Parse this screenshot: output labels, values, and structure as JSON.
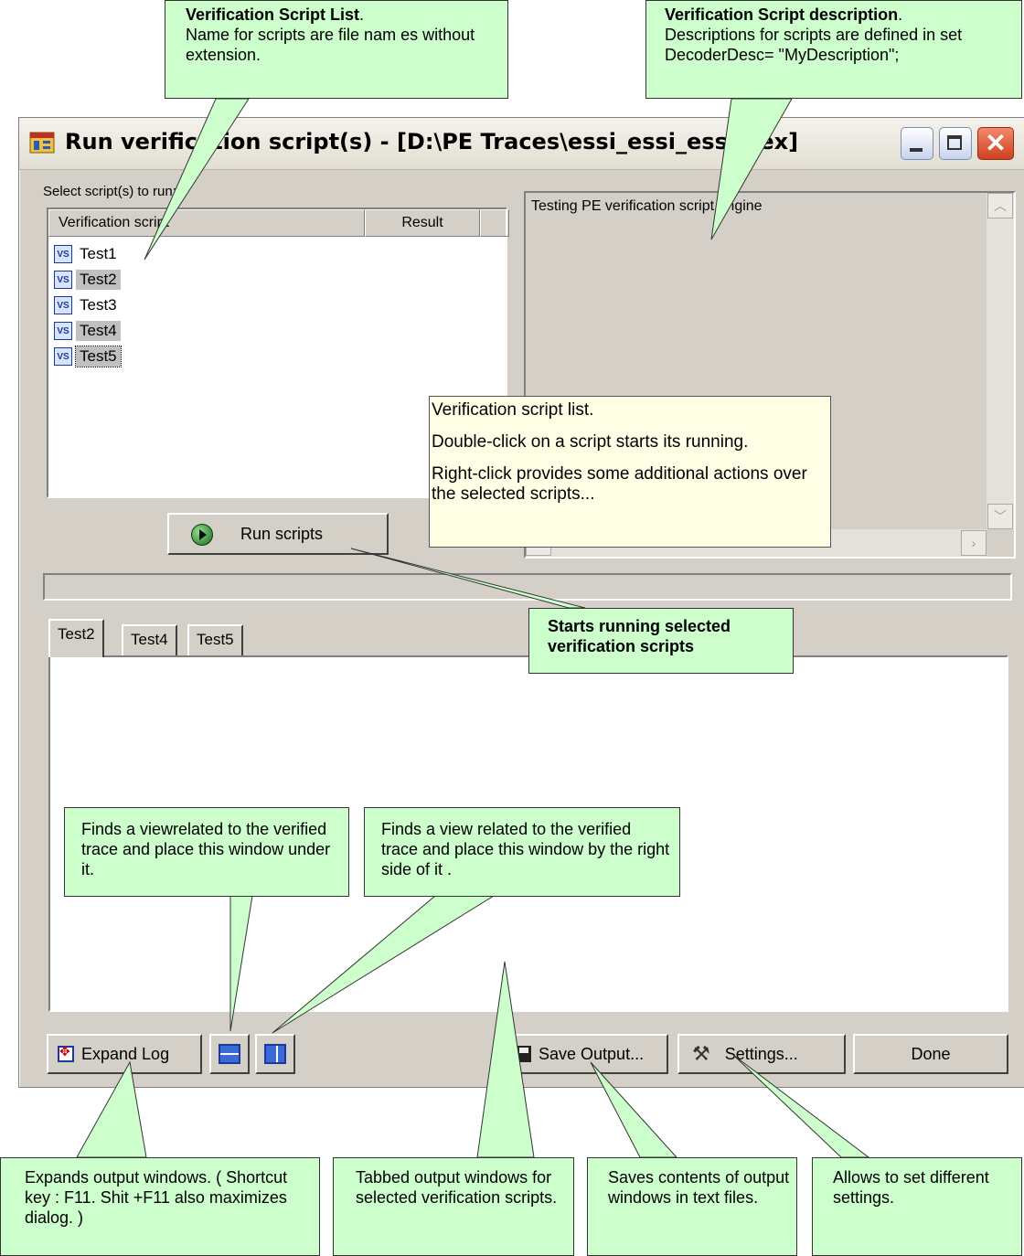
{
  "window": {
    "title": "Run verification script(s) - [D:\\PE Traces\\essi_essi_essi.pex]"
  },
  "script_panel": {
    "select_label": "Select script(s) to run:",
    "columns": [
      "Verification script",
      "Result",
      ""
    ],
    "scripts": [
      {
        "name": "Test1",
        "selected": false
      },
      {
        "name": "Test2",
        "selected": true
      },
      {
        "name": "Test3",
        "selected": false
      },
      {
        "name": "Test4",
        "selected": true
      },
      {
        "name": "Test5",
        "selected": true
      }
    ],
    "run_button": "Run scripts"
  },
  "description": {
    "text": "Testing PE verification script engine"
  },
  "tooltip": {
    "lines": [
      "Verification script list.",
      "Double-click on a script starts its running.",
      "Right-click provides some additional actions over the selected scripts..."
    ]
  },
  "tabs": [
    "Test2",
    "Test4",
    "Test5"
  ],
  "bottom_bar": {
    "expand_log": "Expand Log",
    "save_output": "Save Output...",
    "settings": "Settings...",
    "done": "Done"
  },
  "callouts": {
    "script_list": {
      "title": "Verification Script List",
      "body": "Name for scripts are file nam es without extension."
    },
    "script_desc": {
      "title": "Verification Script description",
      "body": "Descriptions for scripts are defined in set DecoderDesc=  \"MyDescription\";"
    },
    "run_selected": {
      "body": "Starts running selected verification scripts"
    },
    "view_under": {
      "body": "Finds a viewrelated to the verified trace and place this window under it."
    },
    "view_right": {
      "body": "Finds a view related to the verified trace and place this window  by the right side of it ."
    },
    "expand": {
      "body": "Expands output windows. ( Shortcut key : F11. Shit +F11 also maximizes dialog. )"
    },
    "tabbed": {
      "body": "Tabbed output windows for selected verification scripts."
    },
    "saves": {
      "body": "Saves contents of output windows in text files."
    },
    "settings": {
      "body": "Allows to set different settings."
    }
  },
  "colors": {
    "callout_bg": "#ccffcc",
    "tooltip_bg": "#ffffe6",
    "dialog_bg": "#d4d0c8",
    "selection": "#c0c0c0"
  }
}
